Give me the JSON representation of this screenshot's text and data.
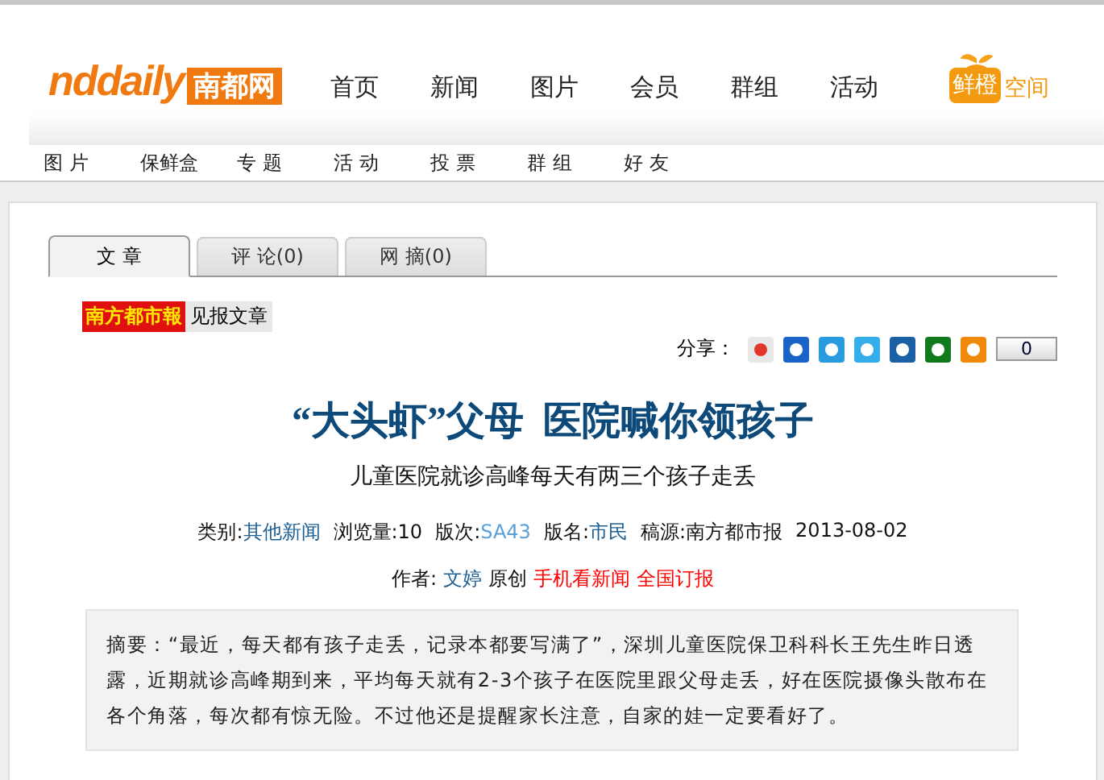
{
  "logo": {
    "latin": "nddaily",
    "chinese": "南都网"
  },
  "nav": [
    "首页",
    "新闻",
    "图片",
    "会员",
    "群组",
    "活动"
  ],
  "brand": {
    "badge": "鲜橙",
    "text": "空间"
  },
  "subnav": [
    "图 片",
    "保鲜盒",
    "专 题",
    "活 动",
    "投 票",
    "群 组",
    "好 友"
  ],
  "tabs": [
    {
      "label": "文 章",
      "selected": true
    },
    {
      "label": "评 论(0)",
      "selected": false
    },
    {
      "label": "网 摘(0)",
      "selected": false
    }
  ],
  "source_badge": {
    "paper": "南方都市報",
    "label": "见报文章"
  },
  "share": {
    "label": "分享：",
    "count": "0"
  },
  "article": {
    "title": "“大头虾”父母  医院喊你领孩子",
    "subtitle": "儿童医院就诊高峰每天有两三个孩子走丢",
    "meta": [
      {
        "label": "类别:",
        "value": "其他新闻",
        "kind": "link"
      },
      {
        "label": "浏览量:",
        "value": "10",
        "kind": "plain"
      },
      {
        "label": "版次:",
        "value": "SA43",
        "kind": "light"
      },
      {
        "label": "版名:",
        "value": "市民",
        "kind": "link"
      },
      {
        "label": "稿源:",
        "value": "南方都市报",
        "kind": "plain"
      }
    ],
    "date": "2013-08-02",
    "author_label": "作者:",
    "author_items": [
      {
        "text": "文婷",
        "kind": "link"
      },
      {
        "text": "原创",
        "kind": "plain"
      },
      {
        "text": "手机看新闻",
        "kind": "red"
      },
      {
        "text": "全国订报",
        "kind": "red"
      }
    ],
    "summary": "摘要：“最近，每天都有孩子走丢，记录本都要写满了”，深圳儿童医院保卫科科长王先生昨日透露，近期就诊高峰期到来，平均每天就有2-3个孩子在医院里跟父母走丢，好在医院摄像头散布在各个角落，每次都有惊无险。不过他还是提醒家长注意，自家的娃一定要看好了。"
  }
}
